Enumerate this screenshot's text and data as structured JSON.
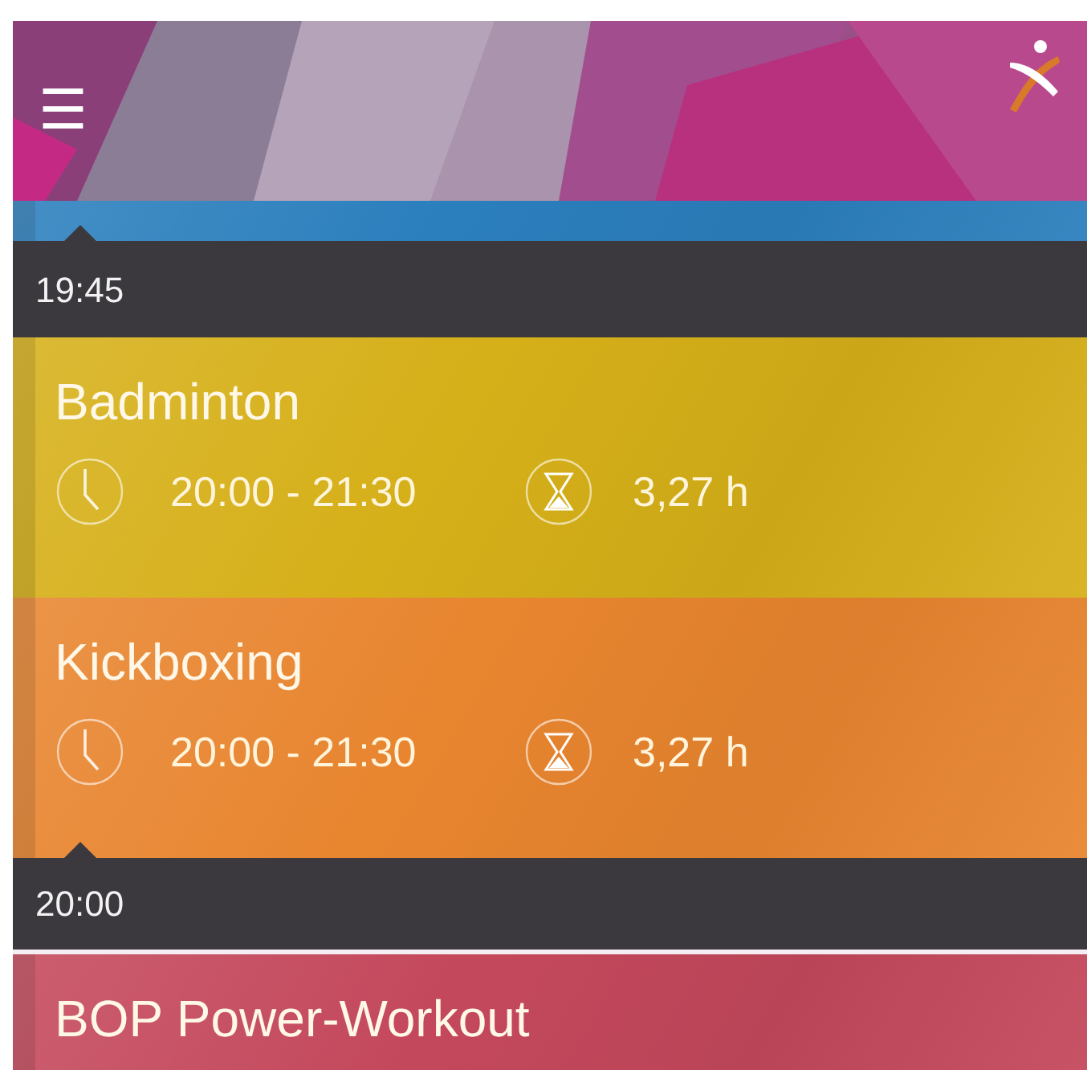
{
  "header": {
    "menu": "☰"
  },
  "timeline": [
    {
      "kind": "card",
      "color": "#2b7fbd"
    },
    {
      "kind": "time",
      "time": "19:45"
    },
    {
      "kind": "card",
      "color": "#d6b019",
      "title": "Badminton",
      "times": "20:00 - 21:30",
      "duration": "3,27 h"
    },
    {
      "kind": "card",
      "color": "#e8852f",
      "title": "Kickboxing",
      "times": "20:00 - 21:30",
      "duration": "3,27 h"
    },
    {
      "kind": "time",
      "time": "20:00"
    },
    {
      "kind": "card",
      "color": "#c4485c",
      "title": "BOP Power-Workout"
    }
  ]
}
